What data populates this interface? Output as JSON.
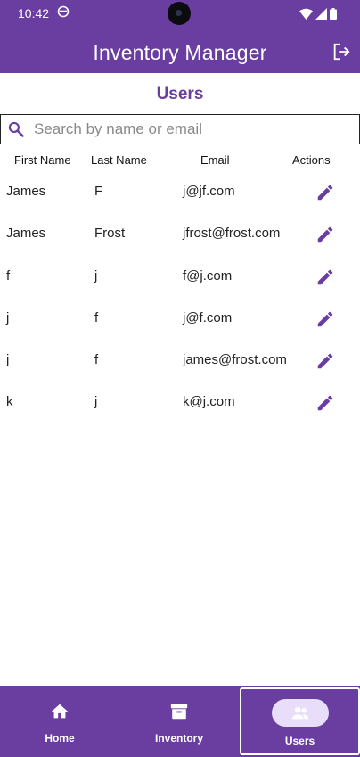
{
  "status_bar": {
    "time": "10:42"
  },
  "app_bar": {
    "title": "Inventory Manager",
    "logout_icon": "logout-icon"
  },
  "page": {
    "title": "Users"
  },
  "search": {
    "placeholder": "Search by name or email",
    "value": ""
  },
  "table": {
    "columns": [
      "First Name",
      "Last Name",
      "Email",
      "Actions"
    ],
    "rows": [
      {
        "first": "James",
        "last": "F",
        "email": "j@jf.com"
      },
      {
        "first": "James",
        "last": "Frost",
        "email": "jfrost@frost.com"
      },
      {
        "first": "f",
        "last": "j",
        "email": "f@j.com"
      },
      {
        "first": "j",
        "last": "f",
        "email": "j@f.com"
      },
      {
        "first": "j",
        "last": "f",
        "email": "james@frost.com"
      },
      {
        "first": "k",
        "last": "j",
        "email": "k@j.com"
      }
    ]
  },
  "bottom_nav": {
    "items": [
      {
        "label": "Home",
        "icon": "home-icon",
        "active": false
      },
      {
        "label": "Inventory",
        "icon": "archive-icon",
        "active": false
      },
      {
        "label": "Users",
        "icon": "people-icon",
        "active": true
      }
    ]
  },
  "colors": {
    "primary": "#6a3ea1",
    "active_pill": "#e8defa"
  }
}
